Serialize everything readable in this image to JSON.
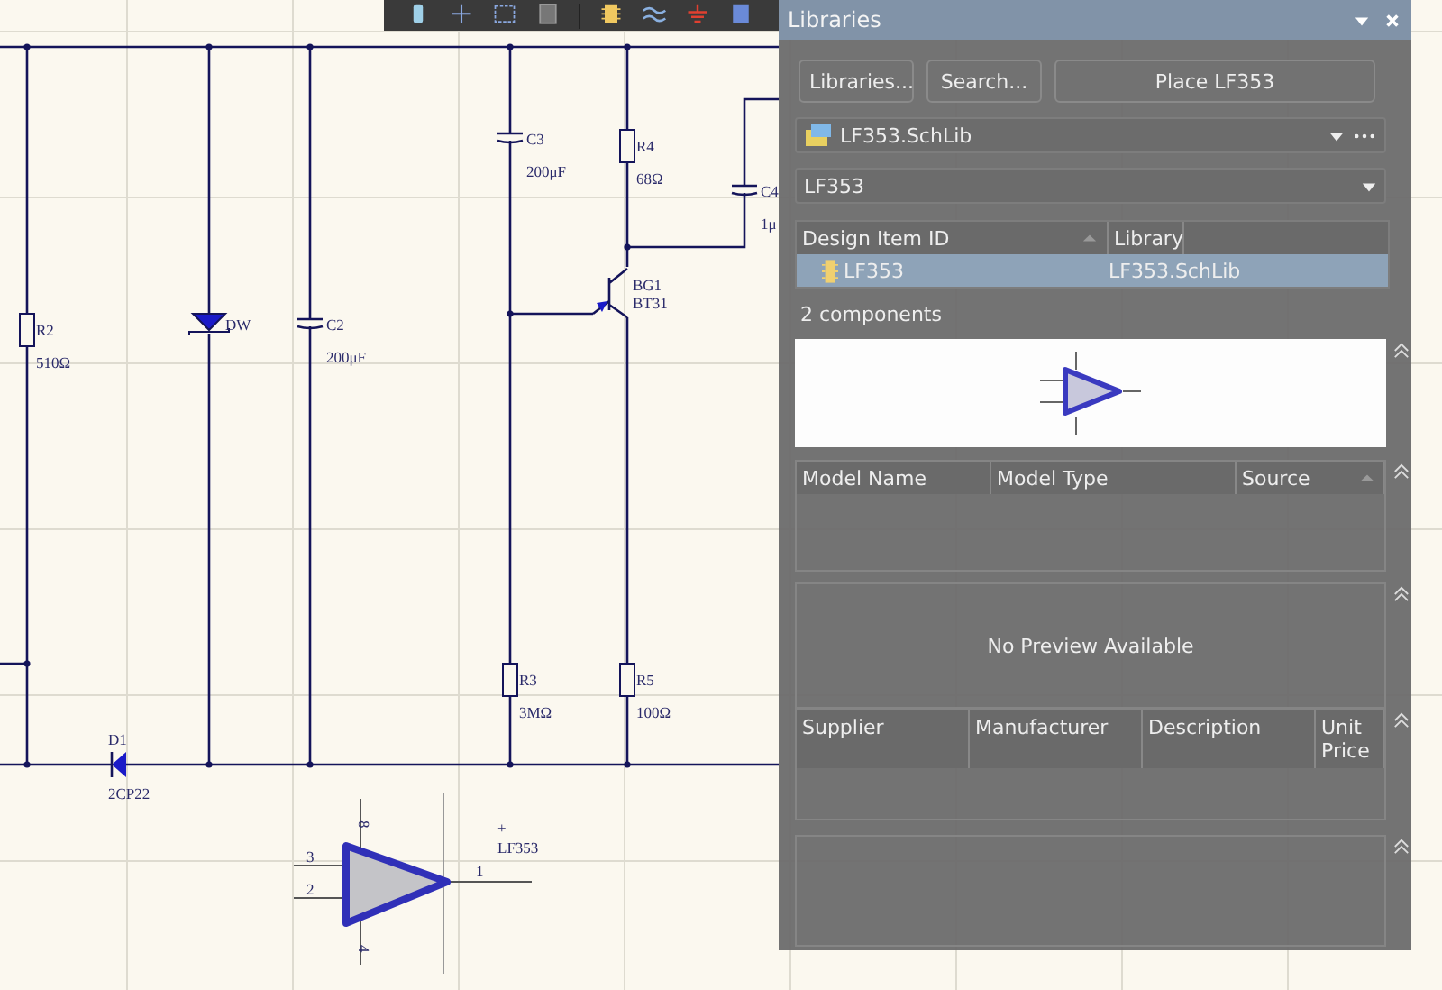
{
  "schematic": {
    "components": [
      {
        "kind": "resistor",
        "designator": "R2",
        "value": "510Ω"
      },
      {
        "kind": "zener",
        "designator": "DW"
      },
      {
        "kind": "capacitor",
        "designator": "C2",
        "value": "200μF"
      },
      {
        "kind": "capacitor",
        "designator": "C3",
        "value": "200μF"
      },
      {
        "kind": "resistor",
        "designator": "R4",
        "value": "68Ω"
      },
      {
        "kind": "capacitor",
        "designator": "C4",
        "value": "1μ"
      },
      {
        "kind": "transistor",
        "designator": "BG1",
        "value": "BT31"
      },
      {
        "kind": "resistor",
        "designator": "R3",
        "value": "3MΩ"
      },
      {
        "kind": "resistor",
        "designator": "R5",
        "value": "100Ω"
      },
      {
        "kind": "diode",
        "designator": "D1",
        "value": "2CP22"
      }
    ],
    "placed_part": {
      "mark": "+",
      "name": "LF353",
      "pins": [
        "3",
        "2",
        "1",
        "8",
        "4"
      ]
    }
  },
  "panel": {
    "title": "Libraries",
    "buttons": [
      "Libraries...",
      "Search...",
      "Place LF353"
    ],
    "library": "LF353.SchLib",
    "filter": "LF353",
    "items": {
      "columns": [
        "Design Item ID",
        "Library"
      ],
      "rows": [
        {
          "cells": [
            "LF353",
            "LF353.SchLib"
          ],
          "selected": true
        }
      ]
    },
    "count": "2 components",
    "models": {
      "columns": [
        "Model Name",
        "Model Type",
        "Source"
      ]
    },
    "model_preview": "No Preview Available",
    "suppliers": {
      "columns": [
        "Supplier",
        "Manufacturer",
        "Description",
        "Unit Price"
      ]
    }
  }
}
